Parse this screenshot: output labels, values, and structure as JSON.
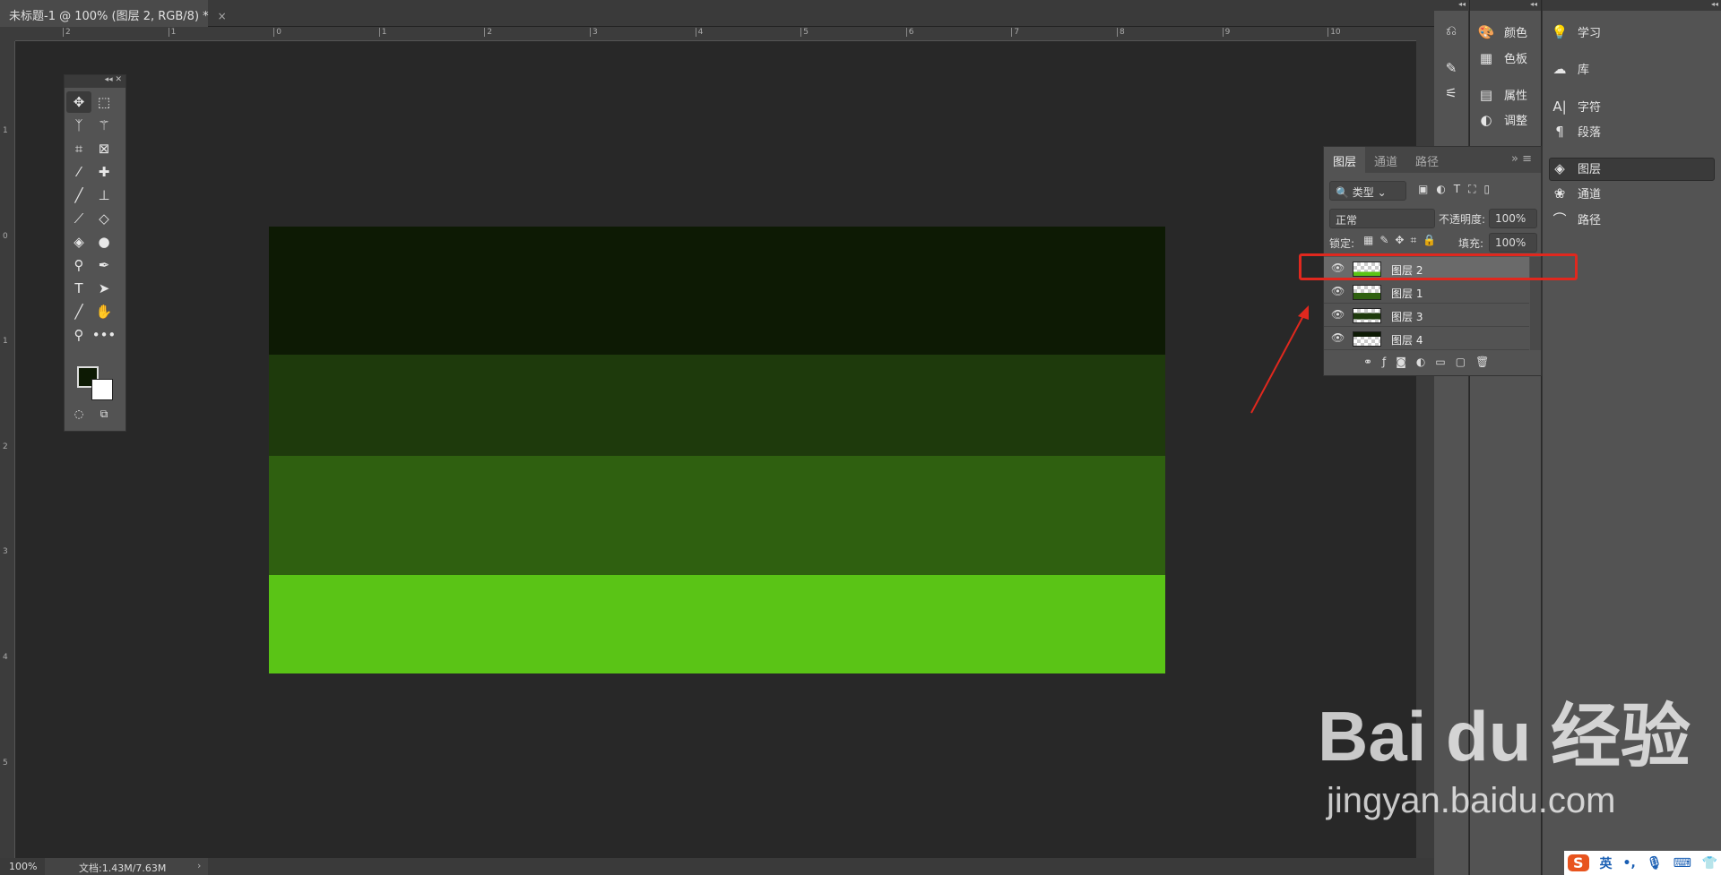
{
  "document": {
    "tab_title": "未标题-1 @ 100% (图层 2, RGB/8) *",
    "close": "×"
  },
  "rulers": {
    "top": [
      "2",
      "1",
      "0",
      "1",
      "2",
      "3",
      "4",
      "5",
      "6",
      "7",
      "8",
      "9",
      "10"
    ],
    "left": [
      "1",
      "0",
      "1",
      "2",
      "3",
      "4",
      "5"
    ]
  },
  "status": {
    "zoom": "100%",
    "doc_info": "文档:1.43M/7.63M",
    "arrow": "›"
  },
  "canvas_bands": [
    "#0d1a04",
    "#1e3a0c",
    "#2f6010",
    "#5ac416"
  ],
  "tools": {
    "items": [
      "move",
      "marquee",
      "lasso",
      "magic-wand",
      "crop",
      "frame",
      "eyedropper",
      "healing",
      "brush",
      "stamp",
      "history-brush",
      "eraser",
      "paint-bucket",
      "blur",
      "dodge",
      "pen",
      "type",
      "path-select",
      "line",
      "hand",
      "zoom",
      "more"
    ],
    "foreground": "#0d1a04",
    "background": "#ffffff"
  },
  "panels": {
    "col2": [
      {
        "icon": "palette-icon",
        "label": "颜色"
      },
      {
        "icon": "grid-icon",
        "label": "色板"
      },
      {
        "icon": "properties-icon",
        "label": "属性"
      },
      {
        "icon": "adjust-icon",
        "label": "调整"
      }
    ],
    "col3": [
      {
        "icon": "bulb-icon",
        "label": "学习"
      },
      {
        "icon": "cc-library-icon",
        "label": "库"
      },
      {
        "icon": "character-icon",
        "label": "字符"
      },
      {
        "icon": "paragraph-icon",
        "label": "段落"
      },
      {
        "icon": "layers-icon",
        "label": "图层"
      },
      {
        "icon": "channels-icon",
        "label": "通道"
      },
      {
        "icon": "paths-icon",
        "label": "路径"
      }
    ]
  },
  "layers_panel": {
    "tabs": [
      "图层",
      "通道",
      "路径"
    ],
    "filter": "类型",
    "blend": "正常",
    "opacity_label": "不透明度:",
    "opacity": "100%",
    "lock_label": "锁定:",
    "fill_label": "填充:",
    "fill": "100%",
    "layers": [
      {
        "name": "图层 2",
        "selected": true
      },
      {
        "name": "图层 1"
      },
      {
        "name": "图层 3"
      },
      {
        "name": "图层 4"
      }
    ]
  },
  "watermark": {
    "brand": "Bai du 经验",
    "url": "jingyan.baidu.com"
  },
  "ime": {
    "logo": "S",
    "lang": "英",
    "punct": "•,"
  }
}
